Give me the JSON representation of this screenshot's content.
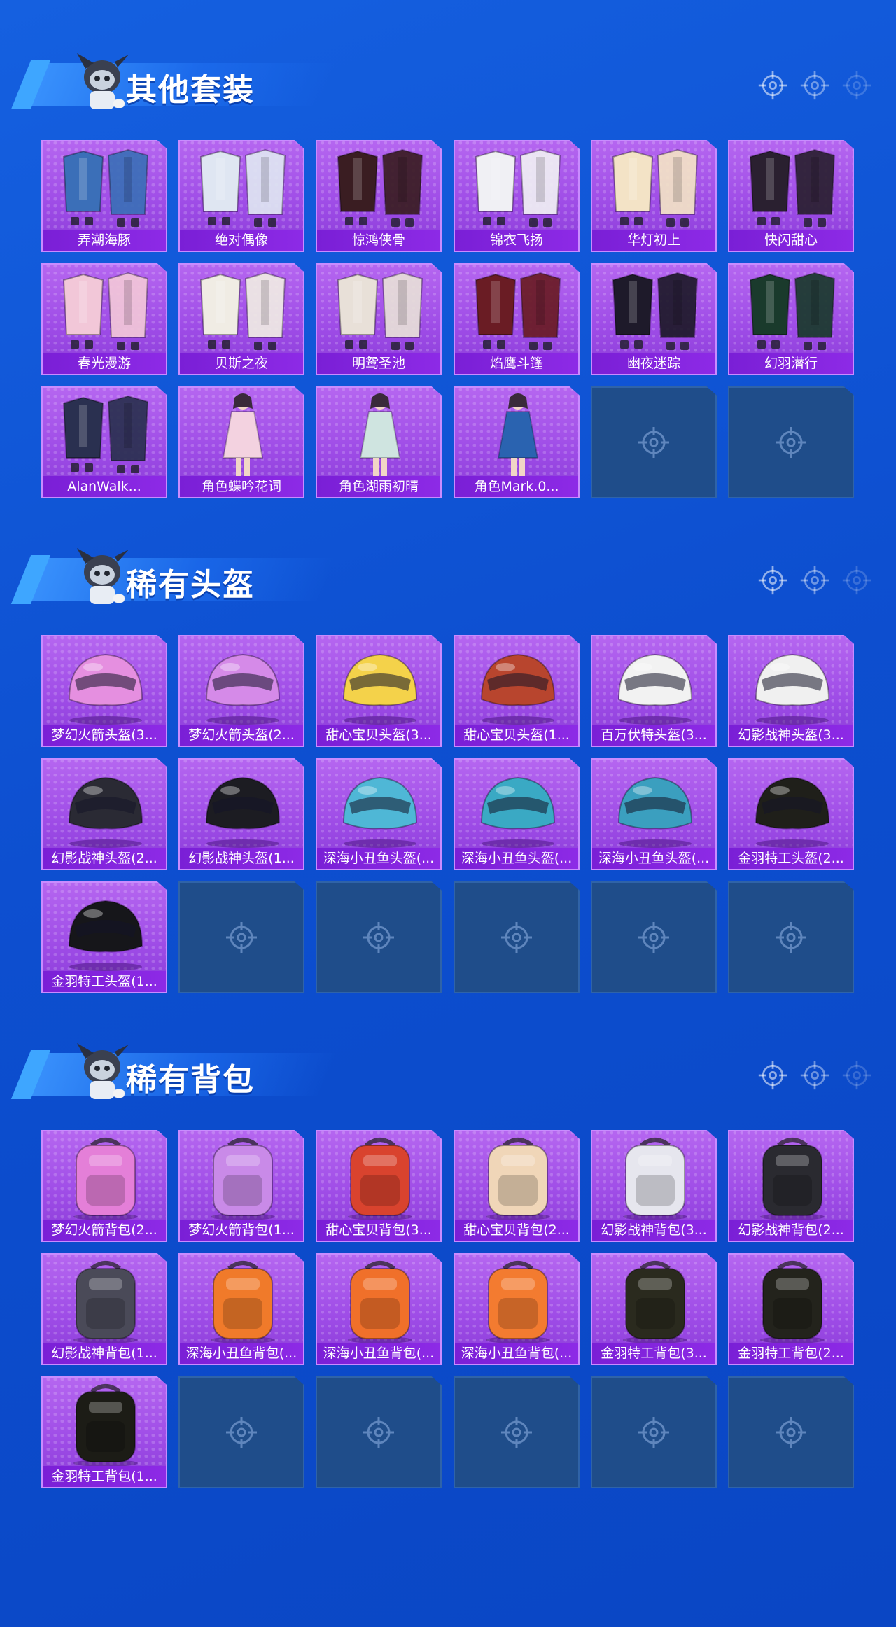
{
  "sections": [
    {
      "title": "其他套装",
      "items": [
        {
          "label": "弄潮海豚",
          "kind": "outfit",
          "color": "#3b6fb8"
        },
        {
          "label": "绝对偶像",
          "kind": "outfit",
          "color": "#dfe6f2"
        },
        {
          "label": "惊鸿侠骨",
          "kind": "outfit",
          "color": "#3a1d22"
        },
        {
          "label": "锦衣飞扬",
          "kind": "outfit",
          "color": "#f0f0f4"
        },
        {
          "label": "华灯初上",
          "kind": "outfit",
          "color": "#f3e3c6"
        },
        {
          "label": "快闪甜心",
          "kind": "outfit",
          "color": "#2a2030"
        },
        {
          "label": "春光漫游",
          "kind": "outfit",
          "color": "#f2c7d8"
        },
        {
          "label": "贝斯之夜",
          "kind": "outfit",
          "color": "#f0ece4"
        },
        {
          "label": "明鸳圣池",
          "kind": "outfit",
          "color": "#e8e0d8"
        },
        {
          "label": "焰鹰斗篷",
          "kind": "outfit",
          "color": "#6a1c24"
        },
        {
          "label": "幽夜迷踪",
          "kind": "outfit",
          "color": "#1e1a2a"
        },
        {
          "label": "幻羽潜行",
          "kind": "outfit",
          "color": "#1a3a2c"
        },
        {
          "label": "AlanWalk...",
          "kind": "outfit",
          "color": "#2a3050"
        },
        {
          "label": "角色蝶吟花词",
          "kind": "character",
          "color": "#f3d2e0"
        },
        {
          "label": "角色湖雨初晴",
          "kind": "character",
          "color": "#cfe4e0"
        },
        {
          "label": "角色Mark.0...",
          "kind": "character",
          "color": "#2a63b0"
        },
        {
          "label": "",
          "kind": "empty"
        },
        {
          "label": "",
          "kind": "empty"
        }
      ]
    },
    {
      "title": "稀有头盔",
      "items": [
        {
          "label": "梦幻火箭头盔(3...",
          "kind": "helmet",
          "color": "#e58fe0"
        },
        {
          "label": "梦幻火箭头盔(2...",
          "kind": "helmet",
          "color": "#d58ae8"
        },
        {
          "label": "甜心宝贝头盔(3...",
          "kind": "helmet",
          "color": "#f4d24a"
        },
        {
          "label": "甜心宝贝头盔(1...",
          "kind": "helmet",
          "color": "#b8452e"
        },
        {
          "label": "百万伏特头盔(3...",
          "kind": "helmet",
          "color": "#f2f2f2"
        },
        {
          "label": "幻影战神头盔(3...",
          "kind": "helmet",
          "color": "#f0f0f0"
        },
        {
          "label": "幻影战神头盔(2...",
          "kind": "helmet",
          "color": "#2a2a34"
        },
        {
          "label": "幻影战神头盔(1...",
          "kind": "helmet",
          "color": "#1c1c22"
        },
        {
          "label": "深海小丑鱼头盔(...",
          "kind": "helmet",
          "color": "#4fb7d6"
        },
        {
          "label": "深海小丑鱼头盔(...",
          "kind": "helmet",
          "color": "#3aa9c4"
        },
        {
          "label": "深海小丑鱼头盔(...",
          "kind": "helmet",
          "color": "#3b9fbf"
        },
        {
          "label": "金羽特工头盔(2...",
          "kind": "helmet",
          "color": "#1f1f1a"
        },
        {
          "label": "金羽特工头盔(1...",
          "kind": "helmet",
          "color": "#16161a"
        },
        {
          "label": "",
          "kind": "empty"
        },
        {
          "label": "",
          "kind": "empty"
        },
        {
          "label": "",
          "kind": "empty"
        },
        {
          "label": "",
          "kind": "empty"
        },
        {
          "label": "",
          "kind": "empty"
        }
      ]
    },
    {
      "title": "稀有背包",
      "items": [
        {
          "label": "梦幻火箭背包(2...",
          "kind": "backpack",
          "color": "#e47fd8"
        },
        {
          "label": "梦幻火箭背包(1...",
          "kind": "backpack",
          "color": "#c98ae8"
        },
        {
          "label": "甜心宝贝背包(3...",
          "kind": "backpack",
          "color": "#d9432e"
        },
        {
          "label": "甜心宝贝背包(2...",
          "kind": "backpack",
          "color": "#f0d6b8"
        },
        {
          "label": "幻影战神背包(3...",
          "kind": "backpack",
          "color": "#e6e6ee"
        },
        {
          "label": "幻影战神背包(2...",
          "kind": "backpack",
          "color": "#2a2a30"
        },
        {
          "label": "幻影战神背包(1...",
          "kind": "backpack",
          "color": "#4a4a58"
        },
        {
          "label": "深海小丑鱼背包(...",
          "kind": "backpack",
          "color": "#f07a2a"
        },
        {
          "label": "深海小丑鱼背包(...",
          "kind": "backpack",
          "color": "#f0702a"
        },
        {
          "label": "深海小丑鱼背包(...",
          "kind": "backpack",
          "color": "#f37b30"
        },
        {
          "label": "金羽特工背包(3...",
          "kind": "backpack",
          "color": "#2a2a1e"
        },
        {
          "label": "金羽特工背包(2...",
          "kind": "backpack",
          "color": "#23231c"
        },
        {
          "label": "金羽特工背包(1...",
          "kind": "backpack",
          "color": "#1c1c16"
        },
        {
          "label": "",
          "kind": "empty"
        },
        {
          "label": "",
          "kind": "empty"
        },
        {
          "label": "",
          "kind": "empty"
        },
        {
          "label": "",
          "kind": "empty"
        },
        {
          "label": "",
          "kind": "empty"
        }
      ]
    }
  ],
  "icons": {
    "header_mascot": "mascot-icon",
    "header_deco": "crosshair-icon",
    "empty_slot": "crosshair-icon"
  },
  "colors": {
    "background": "#0d4fd0",
    "card_purple": "#9d4be6",
    "label_purple": "#7a1fd6",
    "empty_slot": "#1f4d8a"
  }
}
